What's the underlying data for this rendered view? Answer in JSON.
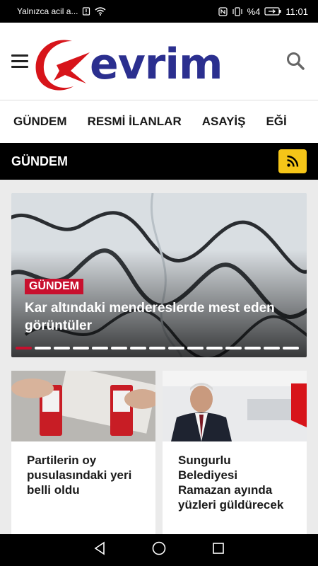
{
  "status_bar": {
    "carrier_text": "Yalnızca acil a...",
    "battery_text": "%4",
    "time": "11:01"
  },
  "header": {
    "logo_text": "evrim",
    "brand_colors": {
      "red": "#d7141a",
      "blue": "#2b2f8f"
    }
  },
  "nav": {
    "items": [
      "GÜNDEM",
      "RESMİ İLANLAR",
      "ASAYİŞ",
      "EĞİ"
    ]
  },
  "section": {
    "title": "GÜNDEM",
    "rss_color": "#f5c518"
  },
  "slider": {
    "category": "GÜNDEM",
    "title": "Kar altındaki menderes­lerde mest eden görüntüler",
    "slide_count": 15,
    "active_index": 0
  },
  "cards": [
    {
      "title": "Partilerin oy pusulasındaki yeri belli oldu"
    },
    {
      "title": "Sungurlu Belediyesi Ramazan ayında yüzleri güldürecek"
    }
  ],
  "icons": {
    "menu": "hamburger-icon",
    "search": "search-icon",
    "rss": "rss-icon",
    "back": "back-icon",
    "home": "home-icon",
    "recents": "recents-icon"
  }
}
